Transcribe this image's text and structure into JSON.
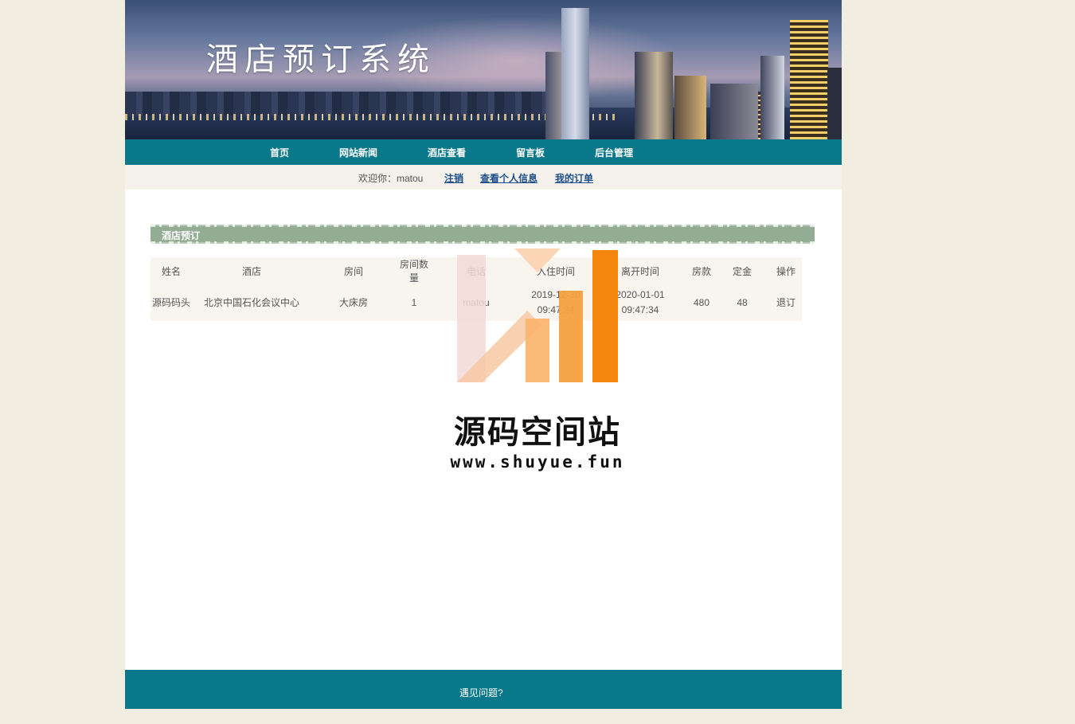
{
  "header": {
    "title": "酒店预订系统"
  },
  "nav": {
    "items": [
      {
        "label": "首页"
      },
      {
        "label": "网站新闻"
      },
      {
        "label": "酒店查看"
      },
      {
        "label": "留言板"
      },
      {
        "label": "后台管理"
      }
    ]
  },
  "userbar": {
    "welcome": "欢迎你：matou",
    "logout": "注销",
    "profile": "查看个人信息",
    "orders": "我的订单"
  },
  "section": {
    "title": "酒店预订"
  },
  "table": {
    "headers": [
      "姓名",
      "酒店",
      "房间",
      "房间数量",
      "电话",
      "入住时间",
      "离开时间",
      "房款",
      "定金",
      "操作"
    ],
    "rows": [
      {
        "name": "源码码头",
        "hotel": "北京中国石化会议中心",
        "room": "大床房",
        "quantity": "1",
        "phone": "matou",
        "checkin_date": "2019-12-30",
        "checkin_time": "09:47:34",
        "checkout_date": "2020-01-01",
        "checkout_time": "09:47:34",
        "price": "480",
        "deposit": "48",
        "action": "退订"
      }
    ]
  },
  "watermark": {
    "name": "源码空间站",
    "url": "www.shuyue.fun"
  },
  "footer": {
    "link": "遇见问题?"
  }
}
